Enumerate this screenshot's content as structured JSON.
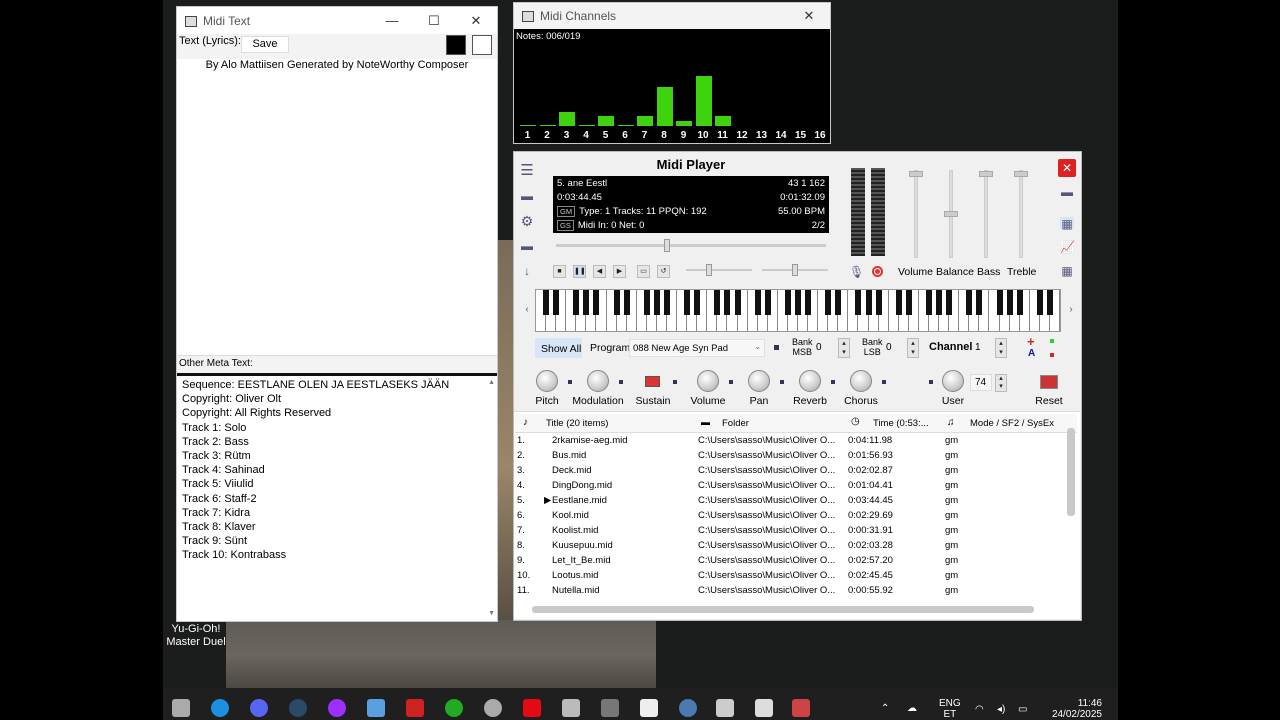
{
  "desktop": {
    "icon_label_1": "Yu-Gi-Oh!",
    "icon_label_2": "Master Duel"
  },
  "midi_text": {
    "title": "Midi Text",
    "lyrics_label": "Text (Lyrics):",
    "save_label": "Save",
    "lyrics": "By Alo Mattiisen Generated by NoteWorthy Composer",
    "meta_label": "Other Meta Text:",
    "meta_lines": [
      "Sequence: EESTLANE OLEN JA EESTLASEKS JÄÄN",
      "Copyright: Oliver Olt",
      "Copyright: All Rights Reserved",
      "Track 1: Solo",
      "Track 2: Bass",
      "Track 3: Rütm",
      "Track 4: Sahinad",
      "Track 5: Viiulid",
      "Track 6: Staff-2",
      "Track 7: Kidra",
      "Track 8: Klaver",
      "Track 9: Sünt",
      "Track 10: Kontrabass"
    ]
  },
  "midi_channels": {
    "title": "Midi Channels",
    "notes": "Notes: 006/019",
    "channels": [
      "1",
      "2",
      "3",
      "4",
      "5",
      "6",
      "7",
      "8",
      "9",
      "10",
      "11",
      "12",
      "13",
      "14",
      "15",
      "16"
    ],
    "levels": [
      0.02,
      0.02,
      0.28,
      0.02,
      0.2,
      0.02,
      0.2,
      0.78,
      0.1,
      1.0,
      0.2,
      0,
      0,
      0,
      0,
      0
    ]
  },
  "midi_player": {
    "title": "Midi Player",
    "lcd": {
      "song": "5. ane   Eestl",
      "counters": "43    1    162",
      "elapsed": "0:03:44.45",
      "remaining": "0:01:32.09",
      "gm_tag": "GM",
      "info": "Type: 1  Tracks: 11  PPQN: 192",
      "bpm": "55.00 BPM",
      "gs_tag": "GS",
      "midi_in": "Midi In: 0   Net: 0",
      "page": "2/2"
    },
    "faders": [
      "Volume",
      "Balance",
      "Bass",
      "Treble"
    ],
    "show_all": "Show All",
    "program_label": "Program",
    "program_value": "088 New Age Syn Pad",
    "bank_msb_label": "Bank\nMSB",
    "bank_msb": "0",
    "bank_lsb_label": "Bank\nLSB",
    "bank_lsb": "0",
    "channel_label": "Channel",
    "channel_value": "1",
    "knobs": [
      "Pitch",
      "Modulation",
      "Sustain",
      "Volume",
      "Pan",
      "Reverb",
      "Chorus",
      "User"
    ],
    "user_value": "74",
    "reset_label": "Reset",
    "playlist": {
      "col_title": "Title (20 items)",
      "col_folder": "Folder",
      "col_time": "Time (0:53:...",
      "col_mode": "Mode / SF2 / SysEx",
      "rows": [
        [
          "1.",
          "2rkamise-aeg.mid",
          "C:\\Users\\sasso\\Music\\Oliver O...",
          "0:04:11.98",
          "gm"
        ],
        [
          "2.",
          "Bus.mid",
          "C:\\Users\\sasso\\Music\\Oliver O...",
          "0:01:56.93",
          "gm"
        ],
        [
          "3.",
          "Deck.mid",
          "C:\\Users\\sasso\\Music\\Oliver O...",
          "0:02:02.87",
          "gm"
        ],
        [
          "4.",
          "DingDong.mid",
          "C:\\Users\\sasso\\Music\\Oliver O...",
          "0:01:04.41",
          "gm"
        ],
        [
          "5.",
          "Eestlane.mid",
          "C:\\Users\\sasso\\Music\\Oliver O...",
          "0:03:44.45",
          "gm"
        ],
        [
          "6.",
          "Kool.mid",
          "C:\\Users\\sasso\\Music\\Oliver O...",
          "0:02:29.69",
          "gm"
        ],
        [
          "7.",
          "Koolist.mid",
          "C:\\Users\\sasso\\Music\\Oliver O...",
          "0:00:31.91",
          "gm"
        ],
        [
          "8.",
          "Kuusepuu.mid",
          "C:\\Users\\sasso\\Music\\Oliver O...",
          "0:02:03.28",
          "gm"
        ],
        [
          "9.",
          "Let_It_Be.mid",
          "C:\\Users\\sasso\\Music\\Oliver O...",
          "0:02:57.20",
          "gm"
        ],
        [
          "10.",
          "Lootus.mid",
          "C:\\Users\\sasso\\Music\\Oliver O...",
          "0:02:45.45",
          "gm"
        ],
        [
          "11.",
          "Nutella.mid",
          "C:\\Users\\sasso\\Music\\Oliver O...",
          "0:00:55.92",
          "gm"
        ]
      ]
    }
  },
  "taskbar": {
    "lang": "ENG",
    "lang2": "ET",
    "time": "11:46",
    "date": "24/02/2025"
  }
}
